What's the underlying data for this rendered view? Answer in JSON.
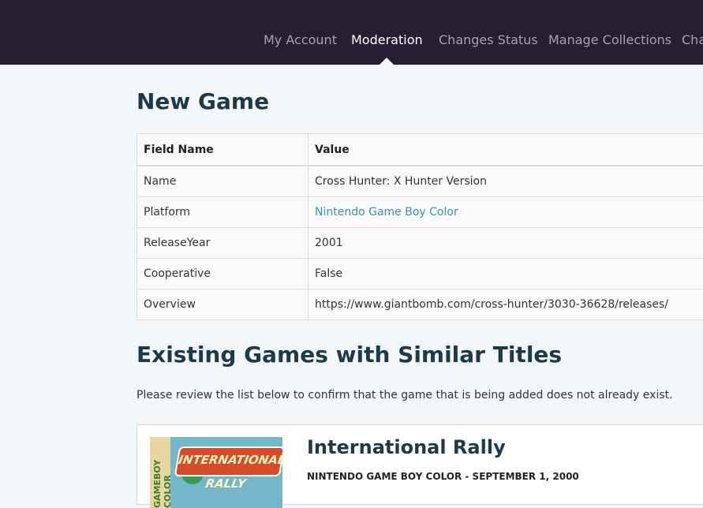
{
  "nav": {
    "items": [
      "My Account",
      "Moderation",
      "Changes Status",
      "Manage Collections",
      "Cha"
    ],
    "active_index": 1
  },
  "page": {
    "title": "New Game"
  },
  "fields_table": {
    "headers": [
      "Field Name",
      "Value"
    ],
    "rows": [
      {
        "field": "Name",
        "value": "Cross Hunter: X Hunter Version"
      },
      {
        "field": "Platform",
        "value": "Nintendo Game Boy Color"
      },
      {
        "field": "ReleaseYear",
        "value": "2001"
      },
      {
        "field": "Cooperative",
        "value": "False"
      },
      {
        "field": "Overview",
        "value": "https://www.giantbomb.com/cross-hunter/3030-36628/releases/"
      }
    ]
  },
  "similar": {
    "heading": "Existing Games with Similar Titles",
    "note": "Please review the list below to confirm that the game that is being added does not already exist.",
    "games": [
      {
        "title": "International Rally",
        "meta": "NINTENDO GAME BOY COLOR - SEPTEMBER 1, 2000",
        "cover_strip_text": "GAMEBOY COLOR",
        "cover_logo_text": "INTERNATIONAL RALLY"
      }
    ]
  },
  "colors": {
    "nav_bg": "#271e33",
    "heading": "#1e3a4a",
    "link": "#3a8fb7",
    "page_bg": "#f4f7fa"
  }
}
